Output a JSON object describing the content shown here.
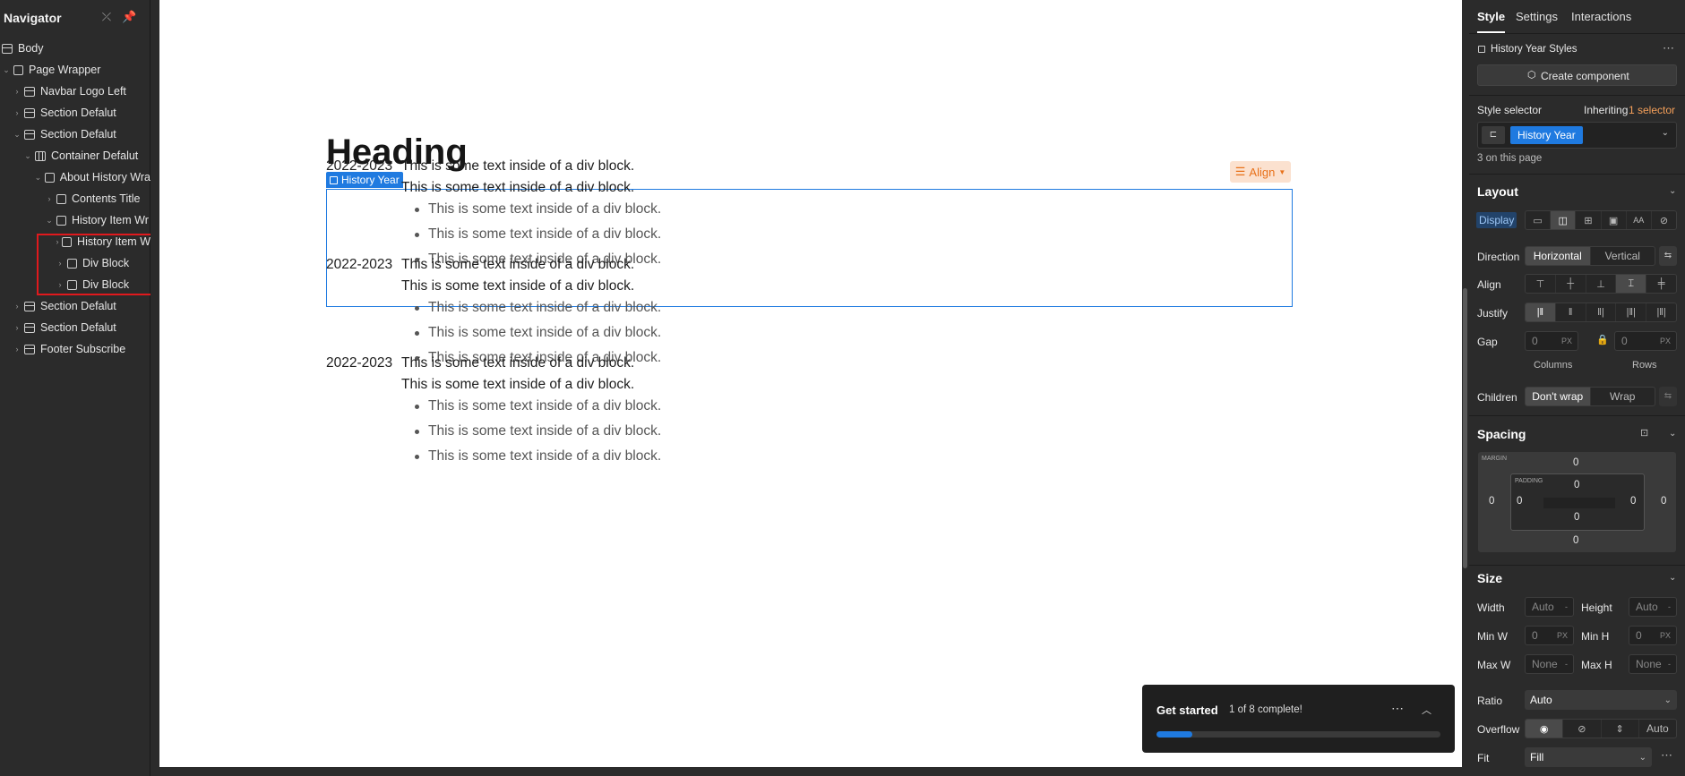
{
  "navigator": {
    "title": "Navigator",
    "items": [
      {
        "label": "Body",
        "depth": 0
      },
      {
        "label": "Page Wrapper",
        "depth": 0
      },
      {
        "label": "Navbar Logo Left",
        "depth": 1
      },
      {
        "label": "Section Defalut",
        "depth": 1
      },
      {
        "label": "Section Defalut",
        "depth": 1
      },
      {
        "label": "Container Defalut",
        "depth": 2
      },
      {
        "label": "About History Wra",
        "depth": 3
      },
      {
        "label": "Contents Title",
        "depth": 4
      },
      {
        "label": "History Item Wr",
        "depth": 4
      },
      {
        "label": "History Item W",
        "depth": 5
      },
      {
        "label": "Div Block",
        "depth": 5
      },
      {
        "label": "Div Block",
        "depth": 5
      },
      {
        "label": "Section Defalut",
        "depth": 1
      },
      {
        "label": "Section Defalut",
        "depth": 1
      },
      {
        "label": "Footer Subscribe",
        "depth": 1
      }
    ]
  },
  "canvas": {
    "heading": "Heading",
    "selected_badge": "History Year",
    "align_label": "Align",
    "items": [
      {
        "year": "2022-2023",
        "text": "This is some text inside of a div block.",
        "text2": "This is some text inside of a div block.",
        "bullets": [
          "This is some text inside of a div block.",
          "This is some text inside of a div block.",
          "This is some text inside of a div block."
        ]
      },
      {
        "year": "2022-2023",
        "text": "This is some text inside of a div block.",
        "text2": "This is some text inside of a div block.",
        "bullets": [
          "This is some text inside of a div block.",
          "This is some text inside of a div block.",
          "This is some text inside of a div block."
        ]
      },
      {
        "year": "2022-2023",
        "text": "This is some text inside of a div block.",
        "text2": "This is some text inside of a div block.",
        "bullets": [
          "This is some text inside of a div block.",
          "This is some text inside of a div block.",
          "This is some text inside of a div block."
        ]
      }
    ]
  },
  "get_started": {
    "title": "Get started",
    "progress_text": "1 of 8 complete!",
    "progress": 0.125
  },
  "style_panel": {
    "tabs": [
      "Style",
      "Settings",
      "Interactions"
    ],
    "element_styles": "History Year Styles",
    "create_component": "Create component",
    "style_selector_label": "Style selector",
    "inheriting": "Inheriting",
    "inheriting_count": "1 selector",
    "selector_chip": "History Year",
    "on_page": "3 on this page",
    "layout": {
      "title": "Layout",
      "display_label": "Display",
      "direction_label": "Direction",
      "direction_options": [
        "Horizontal",
        "Vertical"
      ],
      "align_label": "Align",
      "justify_label": "Justify",
      "gap_label": "Gap",
      "gap_columns": "0",
      "gap_rows": "0",
      "gap_unit": "PX",
      "columns_label": "Columns",
      "rows_label": "Rows",
      "children_label": "Children",
      "children_options": [
        "Don't wrap",
        "Wrap"
      ]
    },
    "spacing": {
      "title": "Spacing",
      "margin_label": "MARGIN",
      "padding_label": "PADDING",
      "margin": {
        "top": "0",
        "right": "0",
        "bottom": "0",
        "left": "0"
      },
      "padding": {
        "top": "0",
        "right": "0",
        "bottom": "0",
        "left": "0"
      }
    },
    "size": {
      "title": "Size",
      "width_label": "Width",
      "width": "Auto",
      "height_label": "Height",
      "height": "Auto",
      "minw_label": "Min W",
      "minw": "0",
      "minh_label": "Min H",
      "minh": "0",
      "maxw_label": "Max W",
      "maxw": "None",
      "maxh_label": "Max H",
      "maxh": "None",
      "unit": "PX",
      "dash": "-",
      "ratio_label": "Ratio",
      "ratio": "Auto",
      "overflow_label": "Overflow",
      "overflow_auto": "Auto",
      "fit_label": "Fit",
      "fit": "Fill"
    }
  },
  "colors": {
    "accent": "#1f7ae0",
    "align_orange": "#e8711a",
    "highlight_red": "#e0191d",
    "inherit_orange": "#f5a05a"
  }
}
